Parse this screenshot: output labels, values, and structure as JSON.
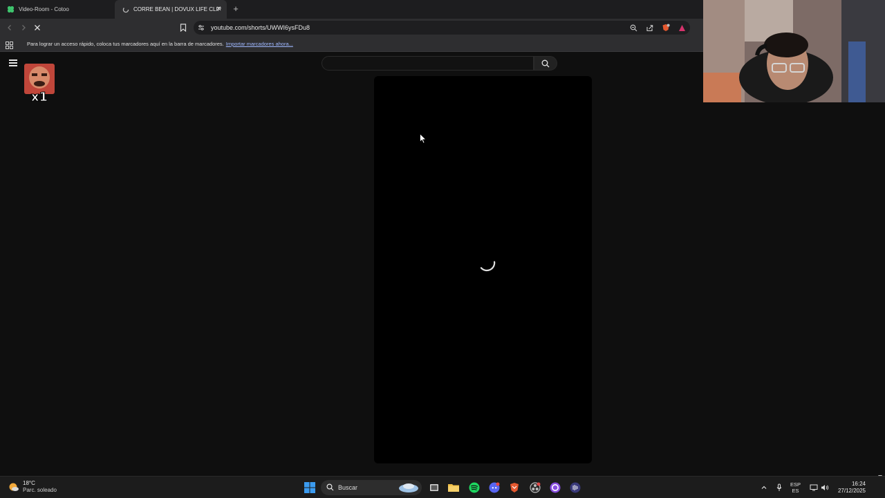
{
  "browser": {
    "tabs": [
      {
        "title": "Video-Room - Cotoo",
        "active": false
      },
      {
        "title": "CORRE BEAN | DOVUX LIFE CLIP",
        "active": true
      }
    ],
    "url": "youtube.com/shorts/UWWI6ysFDu8",
    "bookmarks_bar": {
      "message": "Para lograr un acceso rápido, coloca tus marcadores aquí en la barra de marcadores.",
      "import_link": "Importar marcadores ahora..."
    }
  },
  "page": {
    "search_placeholder": "",
    "video_state": "loading"
  },
  "taskbar": {
    "weather": {
      "temp": "18°C",
      "condition": "Parc. soleado"
    },
    "search_label": "Buscar",
    "lang_top": "ESP",
    "lang_bottom": "ES",
    "time": "16:24",
    "date": "27/12/2025"
  },
  "colors": {
    "chrome_bg": "#2e2e30",
    "page_bg": "#0f0f0f",
    "video_bg": "#000000",
    "link": "#9fb8ff"
  }
}
